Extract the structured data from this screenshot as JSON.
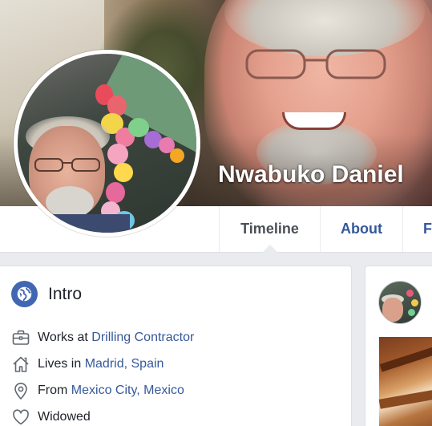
{
  "profile": {
    "name": "Nwabuko Daniel"
  },
  "nav": {
    "tabs": [
      {
        "label": "Timeline",
        "active": true
      },
      {
        "label": "About",
        "active": false
      },
      {
        "label": "F",
        "active": false
      }
    ]
  },
  "intro": {
    "title": "Intro",
    "work": {
      "prefix": "Works at",
      "link": "Drilling Contractor"
    },
    "lives": {
      "prefix": "Lives in",
      "link": "Madrid, Spain"
    },
    "from": {
      "prefix": "From",
      "link": "Mexico City, Mexico"
    },
    "relationship": {
      "text": "Widowed"
    }
  },
  "icons": {
    "intro": "globe-icon",
    "work": "briefcase-icon",
    "lives": "home-icon",
    "from": "location-pin-icon",
    "relationship": "heart-icon"
  },
  "colors": {
    "link": "#365899",
    "brand": "#4267b2",
    "text": "#1d2129",
    "background": "#e9ebee"
  }
}
